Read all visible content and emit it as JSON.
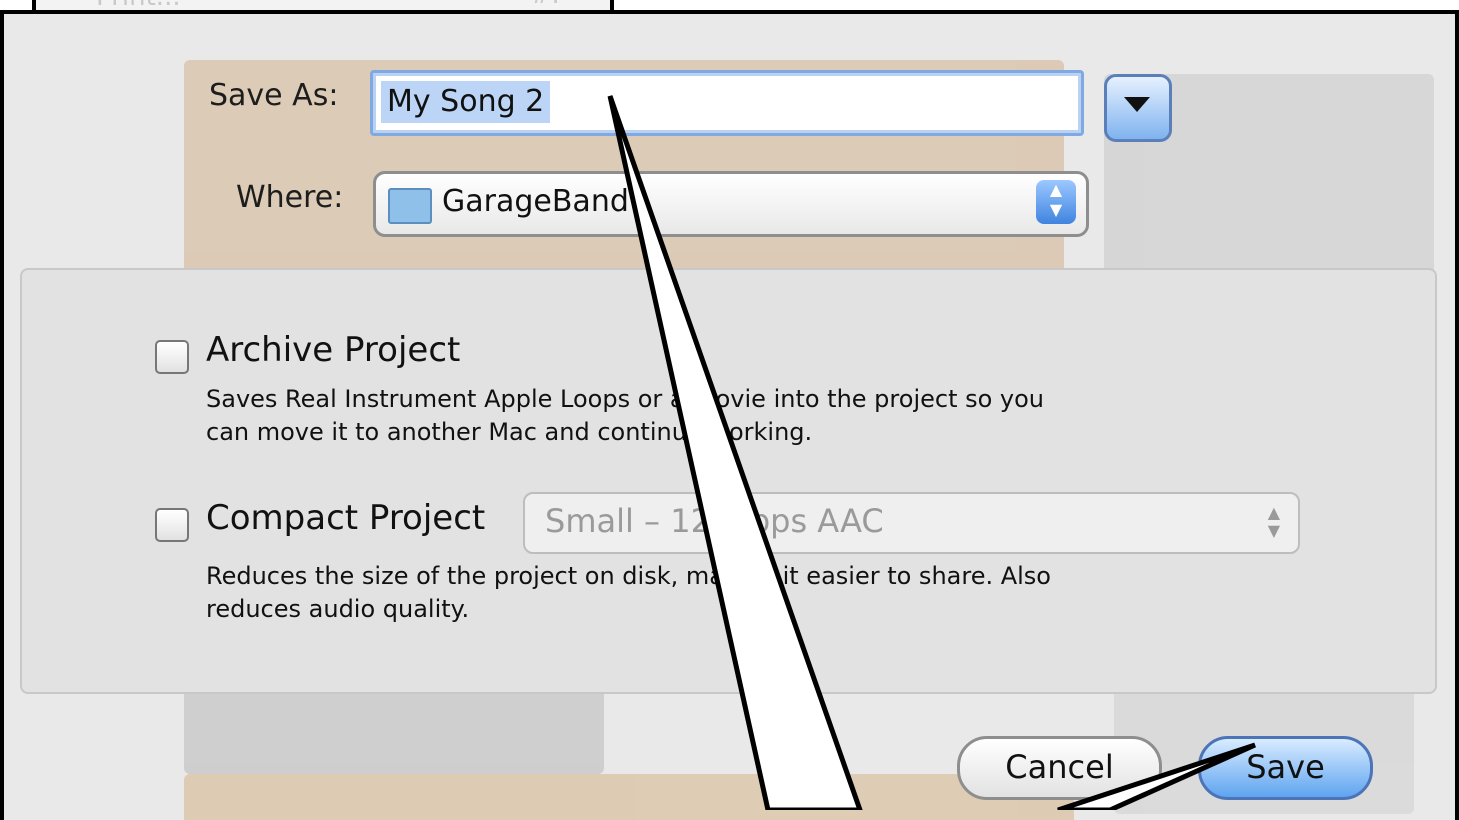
{
  "menu_remnant": {
    "left_text": "Print...",
    "right_text": "#P"
  },
  "save_dialog": {
    "save_as_label": "Save As:",
    "save_as_value": "My Song 2",
    "where_label": "Where:",
    "where_value": "GarageBand",
    "options": {
      "archive": {
        "label": "Archive Project",
        "checked": false,
        "description_line1": "Saves Real Instrument Apple Loops or a movie into the project so you",
        "description_line2": "can move it to another Mac and continue working."
      },
      "compact": {
        "label": "Compact Project",
        "checked": false,
        "quality_value": "Small – 128kbps AAC",
        "description_line1": "Reduces the size of the project on disk, making it easier to share. Also",
        "description_line2": "reduces audio quality."
      }
    },
    "buttons": {
      "cancel": "Cancel",
      "save": "Save"
    }
  },
  "colors": {
    "selection": "#bcd5f6",
    "accent": "#5ea4f0"
  },
  "icons": [
    "folder-icon",
    "disclosure-arrow-icon",
    "popup-stepper-icon"
  ]
}
